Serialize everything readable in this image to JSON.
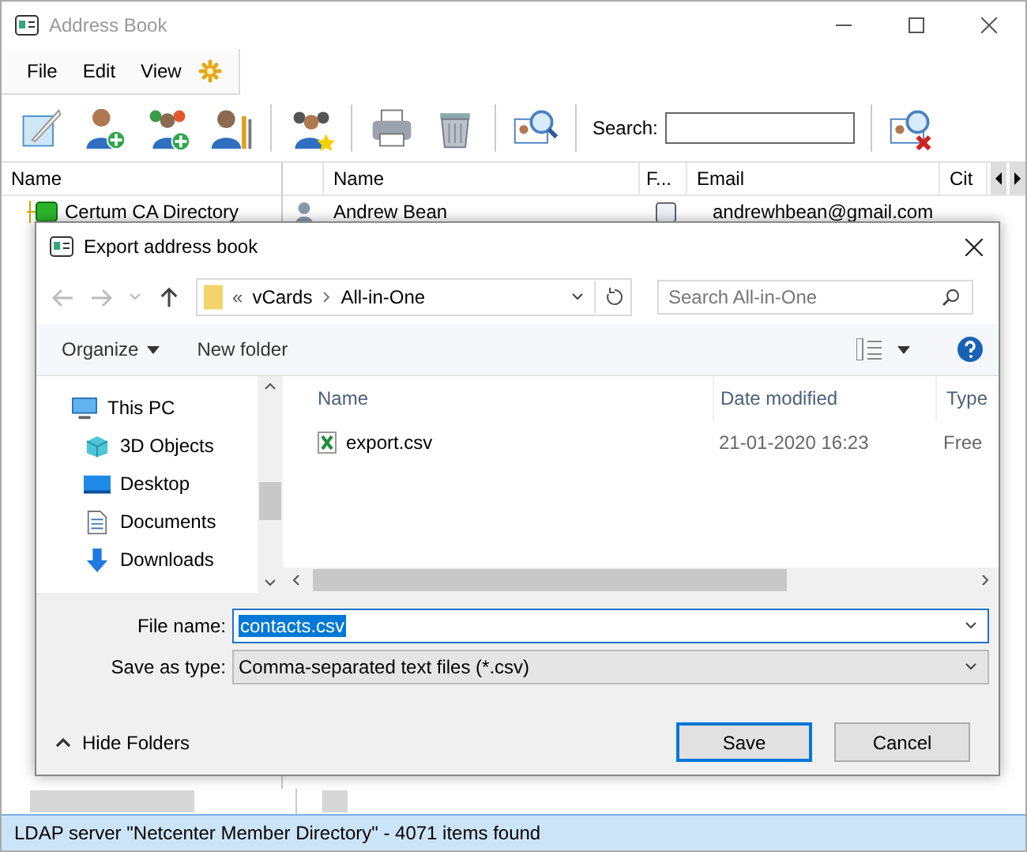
{
  "window": {
    "title": "Address Book"
  },
  "menu": [
    "File",
    "Edit",
    "View"
  ],
  "toolbar": {
    "search_label": "Search:"
  },
  "tree": {
    "header": "Name",
    "items": [
      {
        "label": "Certum CA Directory"
      }
    ]
  },
  "contacts": {
    "columns": [
      "Name",
      "F...",
      "Email",
      "Cit"
    ],
    "rows": [
      {
        "name": "Andrew Bean",
        "email": "andrewhbean@gmail.com"
      }
    ]
  },
  "dialog": {
    "title": "Export address book",
    "path_prefix": "«",
    "path": [
      "vCards",
      "All-in-One"
    ],
    "search_placeholder": "Search All-in-One",
    "commands": [
      "Organize",
      "New folder"
    ],
    "nav_items": [
      {
        "label": "This PC",
        "kind": "pc",
        "children": [
          {
            "label": "3D Objects",
            "kind": "objects"
          },
          {
            "label": "Desktop",
            "kind": "desktop"
          },
          {
            "label": "Documents",
            "kind": "documents"
          },
          {
            "label": "Downloads",
            "kind": "downloads"
          }
        ]
      }
    ],
    "columns": [
      "Name",
      "Date modified",
      "Type"
    ],
    "files": [
      {
        "name": "export.csv",
        "date": "21-01-2020 16:23",
        "type": "Free"
      }
    ],
    "file_name_label": "File name:",
    "file_name": "contacts.csv",
    "save_type_label": "Save as type:",
    "save_type": "Comma-separated text files (*.csv)",
    "hide_folders": "Hide Folders",
    "buttons": [
      {
        "label": "Save",
        "default": true
      },
      {
        "label": "Cancel",
        "default": false
      }
    ]
  },
  "status_bar": "LDAP server \"Netcenter Member Directory\" - 4071 items found"
}
